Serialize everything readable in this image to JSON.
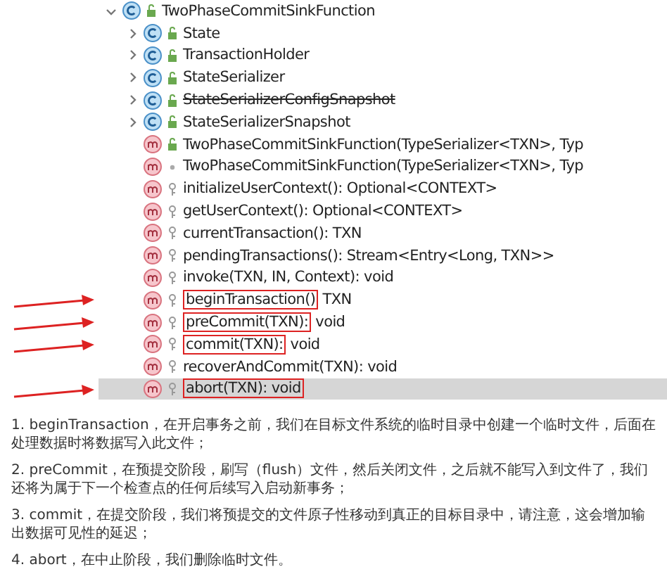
{
  "structure_tree": {
    "label": "TwoPhaseCommitSinkFunction",
    "kind": "class",
    "expanded": true,
    "children": [
      {
        "kind": "class",
        "label": "State",
        "expanded": false,
        "deprecated": false
      },
      {
        "kind": "class",
        "label": "TransactionHolder",
        "expanded": false,
        "deprecated": false
      },
      {
        "kind": "class",
        "label": "StateSerializer",
        "expanded": false,
        "deprecated": false
      },
      {
        "kind": "class",
        "label": "StateSerializerConfigSnapshot",
        "expanded": false,
        "deprecated": true
      },
      {
        "kind": "class",
        "label": "StateSerializerSnapshot",
        "expanded": false,
        "deprecated": false
      },
      {
        "kind": "public",
        "label": "TwoPhaseCommitSinkFunction(TypeSerializer<TXN>, Typ",
        "selected": false
      },
      {
        "kind": "package",
        "label": "TwoPhaseCommitSinkFunction(TypeSerializer<TXN>, Typ",
        "selected": false
      },
      {
        "kind": "protected",
        "label": "initializeUserContext(): Optional<CONTEXT>",
        "selected": false
      },
      {
        "kind": "protected",
        "label": "getUserContext(): Optional<CONTEXT>",
        "selected": false
      },
      {
        "kind": "protected",
        "label": "currentTransaction(): TXN",
        "selected": false
      },
      {
        "kind": "protected",
        "label": "pendingTransactions(): Stream<Entry<Long, TXN>>",
        "selected": false
      },
      {
        "kind": "protected",
        "label": "invoke(TXN, IN, Context): void",
        "selected": false
      },
      {
        "kind": "protected",
        "boxed": "beginTransaction()",
        "label": "TXN",
        "selected": false
      },
      {
        "kind": "protected",
        "boxed": "preCommit(TXN):",
        "label": "void",
        "selected": false
      },
      {
        "kind": "protected",
        "boxed": "commit(TXN):",
        "label": "void",
        "selected": false
      },
      {
        "kind": "protected",
        "label": "recoverAndCommit(TXN): void",
        "selected": false
      },
      {
        "kind": "protected",
        "boxed": "abort(TXN): void",
        "selected": true
      }
    ]
  },
  "notes": [
    "1. beginTransaction，在开启事务之前，我们在目标文件系统的临时目录中创建一个临时文件，后面在处理数据时将数据写入此文件；",
    "2. preCommit，在预提交阶段，刷写（flush）文件，然后关闭文件，之后就不能写入到文件了，我们还将为属于下一个检查点的任何后续写入启动新事务；",
    "3. commit，在提交阶段，我们将预提交的文件原子性移动到真正的目标目录中，请注意，这会增加输出数据可见性的延迟；",
    "4. abort，在中止阶段，我们删除临时文件。"
  ]
}
